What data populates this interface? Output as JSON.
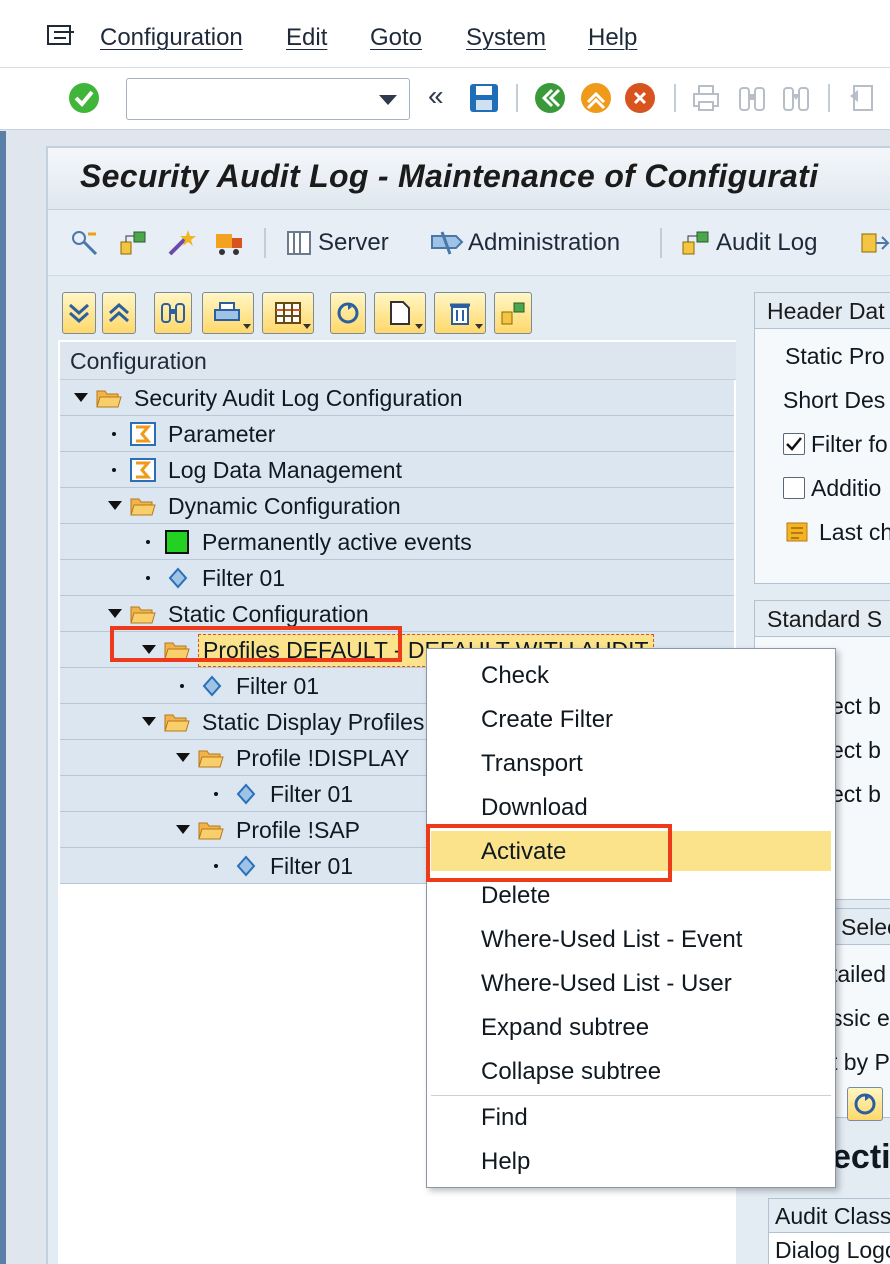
{
  "menu": {
    "items": [
      "Configuration",
      "Edit",
      "Goto",
      "System",
      "Help"
    ]
  },
  "toolbar": {
    "command_field_value": "",
    "nav_back": "«"
  },
  "screen": {
    "title": "Security Audit Log - Maintenance of Configurati"
  },
  "app_toolbar": {
    "server_label": "Server",
    "administration_label": "Administration",
    "audit_log_label": "Audit Log"
  },
  "tree": {
    "header": "Configuration",
    "rows": [
      "Security Audit Log Configuration",
      "Parameter",
      "Log Data Management",
      "Dynamic Configuration",
      "Permanently active events",
      "Filter 01",
      "Static Configuration",
      "Profiles DEFAULT - DEFAULT WITH AUDIT",
      "Filter 01",
      "Static Display Profiles",
      "Profile !DISPLAY",
      "Filter 01",
      "Profile !SAP",
      "Filter 01"
    ]
  },
  "right_panel": {
    "header_data": "Header Dat",
    "static_pro": "Static Pro",
    "short_des": "Short Des",
    "filter_fo": "Filter fo",
    "addition": "Additio",
    "last_ch": "Last ch",
    "standard_s": "Standard S",
    "ect_b1": "ect b",
    "ect_b2": "ect b",
    "ect_b3": "ect b",
    "selec": "Selec",
    "tailed": "tailed",
    "ssic_e": "ssic e",
    "t_by_p": "t by P",
    "ecti": "ecti",
    "audit_class": "Audit Class",
    "dialog_logo": "Dialog Logo"
  },
  "context_menu": {
    "items": [
      "Check",
      "Create Filter",
      "Transport",
      "Download",
      "Activate",
      "Delete",
      "Where-Used List - Event",
      "Where-Used List - User",
      "Expand subtree",
      "Collapse subtree",
      "Find",
      "Help"
    ],
    "highlighted": "Activate"
  },
  "colors": {
    "highlight_red": "#ec3a1b",
    "menu_highlight": "#fbe38c",
    "tree_row_bg": "#dbe6f1"
  }
}
